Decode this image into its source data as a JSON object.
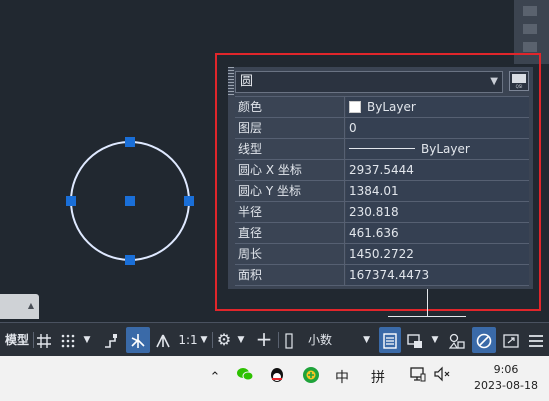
{
  "properties": {
    "object_type": "圆",
    "quick_select_tag": "QSI",
    "rows": [
      {
        "key": "颜色",
        "value": "ByLayer"
      },
      {
        "key": "图层",
        "value": "0"
      },
      {
        "key": "线型",
        "value": "ByLayer"
      },
      {
        "key": "圆心 X 坐标",
        "value": "2937.5444"
      },
      {
        "key": "圆心 Y 坐标",
        "value": "1384.01"
      },
      {
        "key": "半径",
        "value": "230.818"
      },
      {
        "key": "直径",
        "value": "461.636"
      },
      {
        "key": "周长",
        "value": "1450.2722"
      },
      {
        "key": "面积",
        "value": "167374.4473"
      }
    ]
  },
  "statusbar": {
    "model_label": "模型",
    "scale_label": "1:1",
    "units_label": "小数"
  },
  "taskbar": {
    "ime_label": "中",
    "ime_mode_label": "拼",
    "time": "9:06",
    "date": "2023-08-18"
  },
  "colors": {
    "highlight": "#e1262b",
    "grip": "#1a6fd8",
    "circle": "#dfe9ff",
    "accent": "#3a6aa8"
  }
}
